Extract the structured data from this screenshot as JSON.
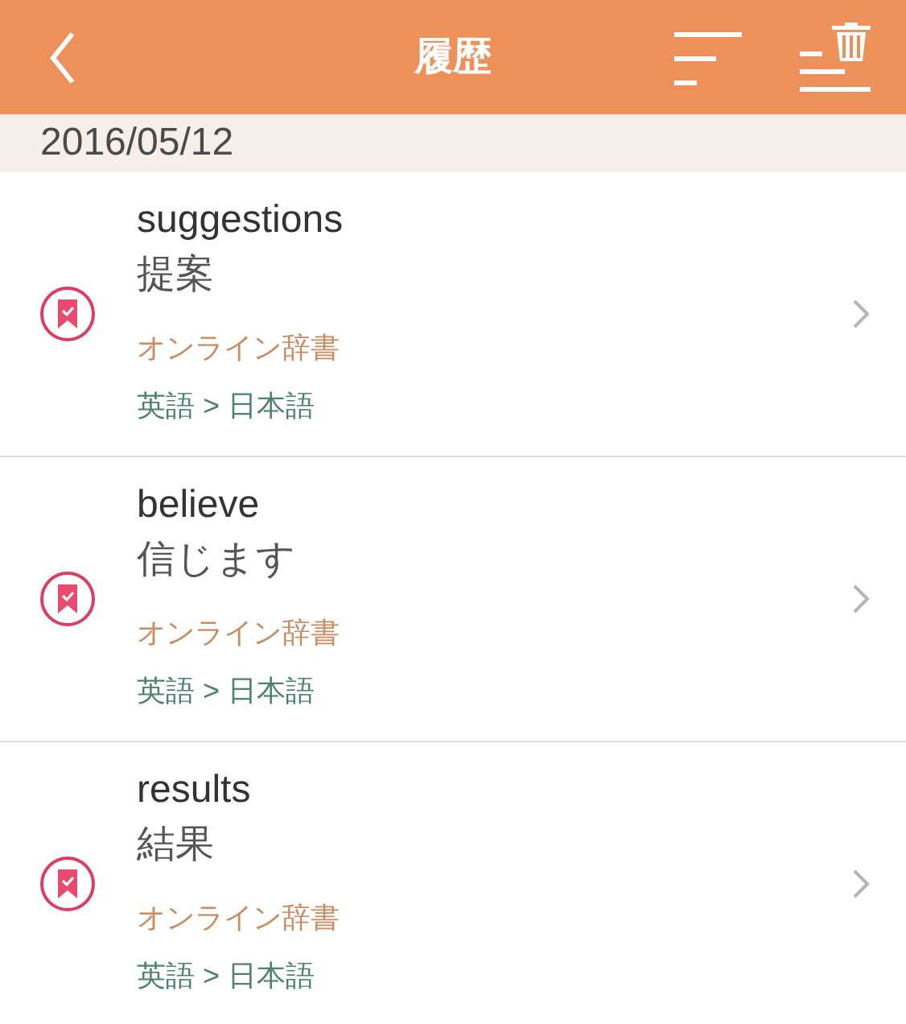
{
  "header": {
    "title": "履歴"
  },
  "date": "2016/05/12",
  "entries": [
    {
      "word": "suggestions",
      "translation": "提案",
      "source": "オンライン辞書",
      "languages": "英語 > 日本語"
    },
    {
      "word": "believe",
      "translation": "信じます",
      "source": "オンライン辞書",
      "languages": "英語 > 日本語"
    },
    {
      "word": "results",
      "translation": "結果",
      "source": "オンライン辞書",
      "languages": "英語 > 日本語"
    }
  ]
}
